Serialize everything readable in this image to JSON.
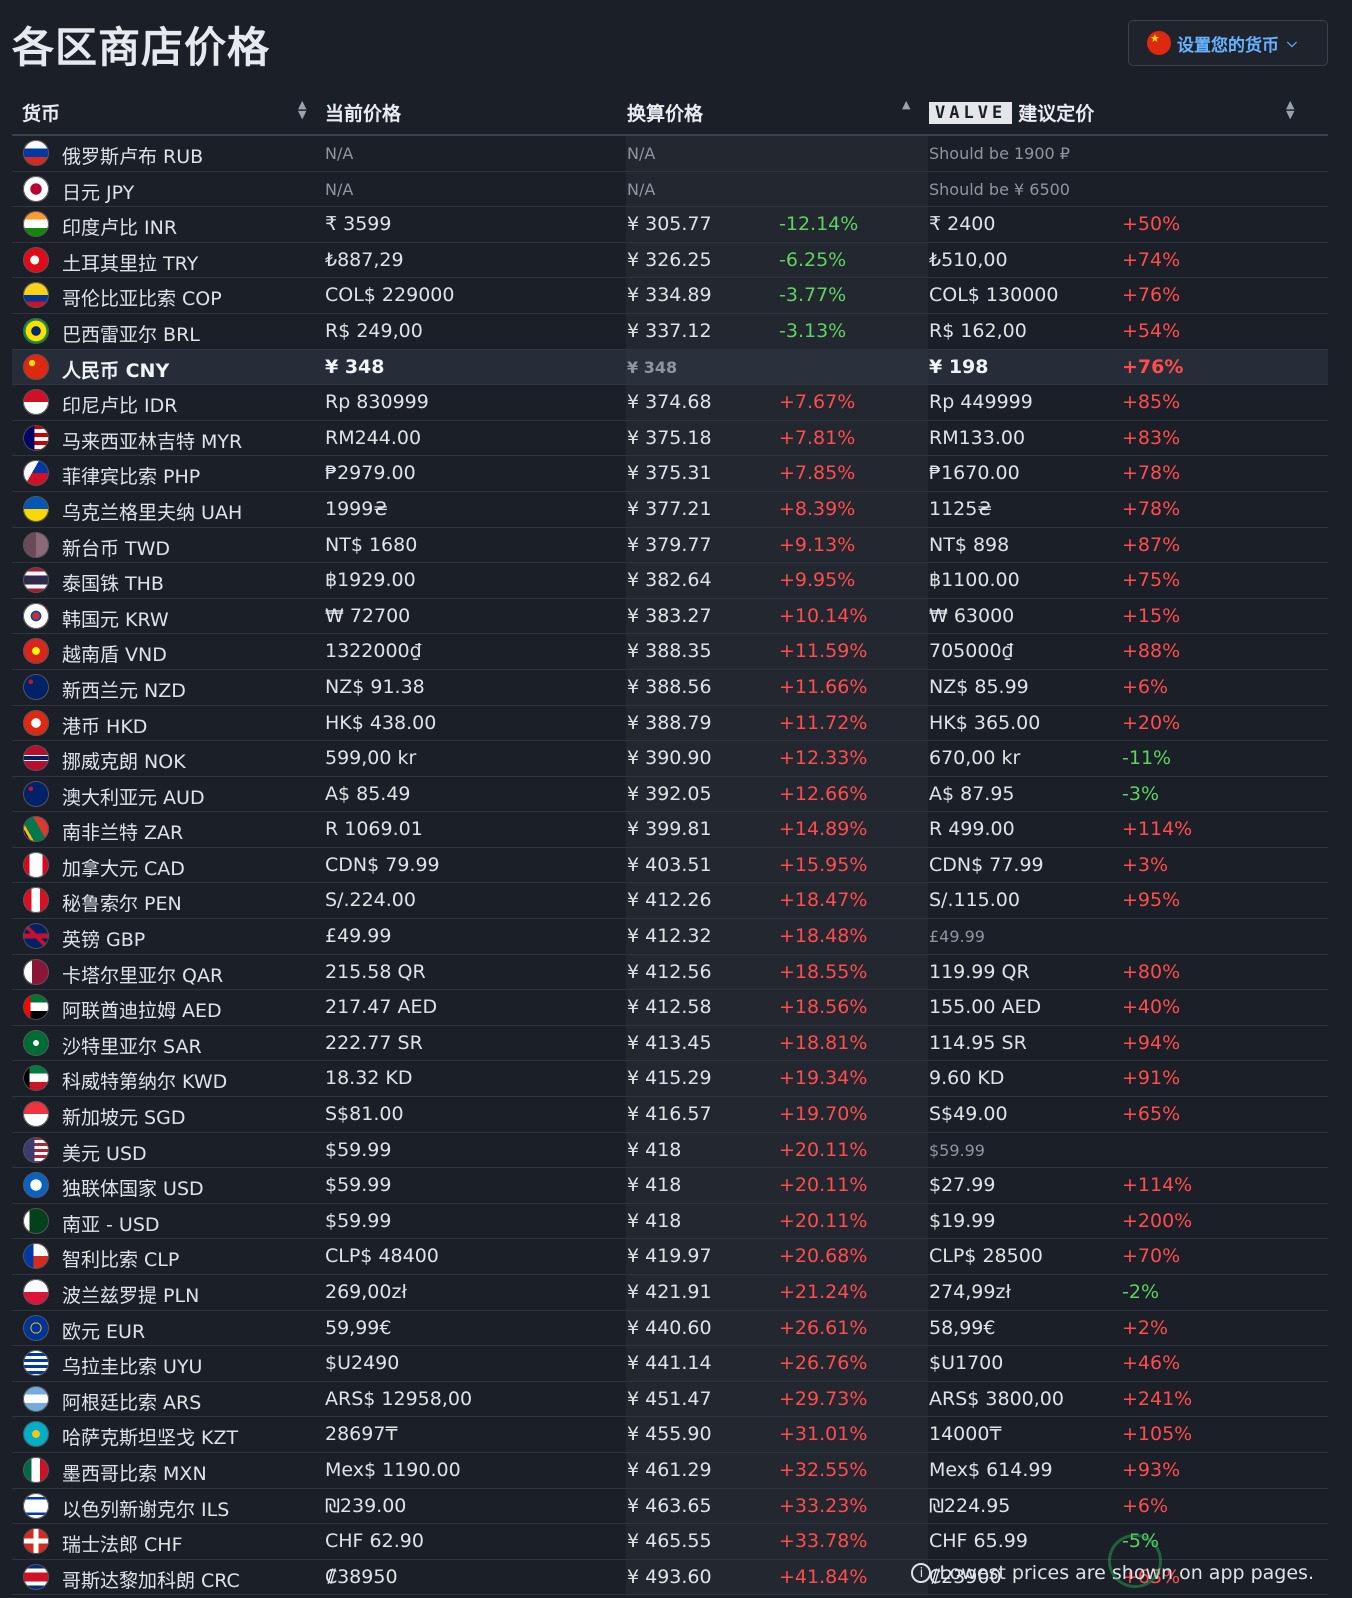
{
  "page": {
    "title": "各区商店价格",
    "currency_button": "设置您的货币",
    "footer_note": "Lowest prices are shown on app pages."
  },
  "colors": {
    "up": "#ff4c4c",
    "down": "#5fd35f",
    "accent": "#66b3ff"
  },
  "headers": {
    "currency": "货币",
    "current_price": "当前价格",
    "converted_price": "换算价格",
    "valve_logo": "VALVE",
    "suggested_price": "建议定价"
  },
  "rows": [
    {
      "flag": "ru",
      "name": "俄罗斯卢布 RUB",
      "price": "N/A",
      "conv": "N/A",
      "diff": "",
      "sugg": "Should be 1900 ₽",
      "pct": "",
      "diff_dir": "",
      "pct_dir": "",
      "na": true
    },
    {
      "flag": "jp",
      "name": "日元 JPY",
      "price": "N/A",
      "conv": "N/A",
      "diff": "",
      "sugg": "Should be ¥ 6500",
      "pct": "",
      "diff_dir": "",
      "pct_dir": "",
      "na": true
    },
    {
      "flag": "in",
      "name": "印度卢比 INR",
      "price": "₹ 3599",
      "conv": "¥ 305.77",
      "diff": "-12.14%",
      "sugg": "₹ 2400",
      "pct": "+50%",
      "diff_dir": "down",
      "pct_dir": "up"
    },
    {
      "flag": "tr",
      "name": "土耳其里拉 TRY",
      "price": "₺887,29",
      "conv": "¥ 326.25",
      "diff": "-6.25%",
      "sugg": "₺510,00",
      "pct": "+74%",
      "diff_dir": "down",
      "pct_dir": "up"
    },
    {
      "flag": "co",
      "name": "哥伦比亚比索 COP",
      "price": "COL$ 229000",
      "conv": "¥ 334.89",
      "diff": "-3.77%",
      "sugg": "COL$ 130000",
      "pct": "+76%",
      "diff_dir": "down",
      "pct_dir": "up"
    },
    {
      "flag": "br",
      "name": "巴西雷亚尔 BRL",
      "price": "R$ 249,00",
      "conv": "¥ 337.12",
      "diff": "-3.13%",
      "sugg": "R$ 162,00",
      "pct": "+54%",
      "diff_dir": "down",
      "pct_dir": "up"
    },
    {
      "flag": "cn",
      "name": "人民币 CNY",
      "price": "¥ 348",
      "conv": "¥ 348",
      "diff": "",
      "sugg": "¥ 198",
      "pct": "+76%",
      "diff_dir": "",
      "pct_dir": "up",
      "highlight": true
    },
    {
      "flag": "id",
      "name": "印尼卢比 IDR",
      "price": "Rp 830999",
      "conv": "¥ 374.68",
      "diff": "+7.67%",
      "sugg": "Rp 449999",
      "pct": "+85%",
      "diff_dir": "up",
      "pct_dir": "up"
    },
    {
      "flag": "my",
      "name": "马来西亚林吉特 MYR",
      "price": "RM244.00",
      "conv": "¥ 375.18",
      "diff": "+7.81%",
      "sugg": "RM133.00",
      "pct": "+83%",
      "diff_dir": "up",
      "pct_dir": "up"
    },
    {
      "flag": "ph",
      "name": "菲律宾比索 PHP",
      "price": "₱2979.00",
      "conv": "¥ 375.31",
      "diff": "+7.85%",
      "sugg": "₱1670.00",
      "pct": "+78%",
      "diff_dir": "up",
      "pct_dir": "up"
    },
    {
      "flag": "ua",
      "name": "乌克兰格里夫纳 UAH",
      "price": "1999₴",
      "conv": "¥ 377.21",
      "diff": "+8.39%",
      "sugg": "1125₴",
      "pct": "+78%",
      "diff_dir": "up",
      "pct_dir": "up"
    },
    {
      "flag": "tw",
      "name": "新台币 TWD",
      "price": "NT$ 1680",
      "conv": "¥ 379.77",
      "diff": "+9.13%",
      "sugg": "NT$ 898",
      "pct": "+87%",
      "diff_dir": "up",
      "pct_dir": "up"
    },
    {
      "flag": "th",
      "name": "泰国铢 THB",
      "price": "฿1929.00",
      "conv": "¥ 382.64",
      "diff": "+9.95%",
      "sugg": "฿1100.00",
      "pct": "+75%",
      "diff_dir": "up",
      "pct_dir": "up"
    },
    {
      "flag": "kr",
      "name": "韩国元 KRW",
      "price": "₩ 72700",
      "conv": "¥ 383.27",
      "diff": "+10.14%",
      "sugg": "₩ 63000",
      "pct": "+15%",
      "diff_dir": "up",
      "pct_dir": "up"
    },
    {
      "flag": "vn",
      "name": "越南盾 VND",
      "price": "1322000₫",
      "conv": "¥ 388.35",
      "diff": "+11.59%",
      "sugg": "705000₫",
      "pct": "+88%",
      "diff_dir": "up",
      "pct_dir": "up"
    },
    {
      "flag": "nz",
      "name": "新西兰元 NZD",
      "price": "NZ$ 91.38",
      "conv": "¥ 388.56",
      "diff": "+11.66%",
      "sugg": "NZ$ 85.99",
      "pct": "+6%",
      "diff_dir": "up",
      "pct_dir": "up"
    },
    {
      "flag": "hk",
      "name": "港币 HKD",
      "price": "HK$ 438.00",
      "conv": "¥ 388.79",
      "diff": "+11.72%",
      "sugg": "HK$ 365.00",
      "pct": "+20%",
      "diff_dir": "up",
      "pct_dir": "up"
    },
    {
      "flag": "no",
      "name": "挪威克朗 NOK",
      "price": "599,00 kr",
      "conv": "¥ 390.90",
      "diff": "+12.33%",
      "sugg": "670,00 kr",
      "pct": "-11%",
      "diff_dir": "up",
      "pct_dir": "down"
    },
    {
      "flag": "au",
      "name": "澳大利亚元 AUD",
      "price": "A$ 85.49",
      "conv": "¥ 392.05",
      "diff": "+12.66%",
      "sugg": "A$ 87.95",
      "pct": "-3%",
      "diff_dir": "up",
      "pct_dir": "down"
    },
    {
      "flag": "za",
      "name": "南非兰特 ZAR",
      "price": "R 1069.01",
      "conv": "¥ 399.81",
      "diff": "+14.89%",
      "sugg": "R 499.00",
      "pct": "+114%",
      "diff_dir": "up",
      "pct_dir": "up"
    },
    {
      "flag": "ca",
      "name": "加拿大元 CAD",
      "price": "CDN$ 79.99",
      "conv": "¥ 403.51",
      "diff": "+15.95%",
      "sugg": "CDN$ 77.99",
      "pct": "+3%",
      "diff_dir": "up",
      "pct_dir": "up"
    },
    {
      "flag": "pe",
      "name": "秘鲁索尔 PEN",
      "price": "S/.224.00",
      "conv": "¥ 412.26",
      "diff": "+18.47%",
      "sugg": "S/.115.00",
      "pct": "+95%",
      "diff_dir": "up",
      "pct_dir": "up"
    },
    {
      "flag": "gb",
      "name": "英镑 GBP",
      "price": "£49.99",
      "conv": "¥ 412.32",
      "diff": "+18.48%",
      "sugg": "£49.99",
      "pct": "",
      "diff_dir": "up",
      "pct_dir": "",
      "sugg_dim": true
    },
    {
      "flag": "qa",
      "name": "卡塔尔里亚尔 QAR",
      "price": "215.58 QR",
      "conv": "¥ 412.56",
      "diff": "+18.55%",
      "sugg": "119.99 QR",
      "pct": "+80%",
      "diff_dir": "up",
      "pct_dir": "up"
    },
    {
      "flag": "ae",
      "name": "阿联酋迪拉姆 AED",
      "price": "217.47 AED",
      "conv": "¥ 412.58",
      "diff": "+18.56%",
      "sugg": "155.00 AED",
      "pct": "+40%",
      "diff_dir": "up",
      "pct_dir": "up"
    },
    {
      "flag": "sa",
      "name": "沙特里亚尔 SAR",
      "price": "222.77 SR",
      "conv": "¥ 413.45",
      "diff": "+18.81%",
      "sugg": "114.95 SR",
      "pct": "+94%",
      "diff_dir": "up",
      "pct_dir": "up"
    },
    {
      "flag": "kw",
      "name": "科威特第纳尔 KWD",
      "price": "18.32 KD",
      "conv": "¥ 415.29",
      "diff": "+19.34%",
      "sugg": "9.60 KD",
      "pct": "+91%",
      "diff_dir": "up",
      "pct_dir": "up"
    },
    {
      "flag": "sg",
      "name": "新加坡元 SGD",
      "price": "S$81.00",
      "conv": "¥ 416.57",
      "diff": "+19.70%",
      "sugg": "S$49.00",
      "pct": "+65%",
      "diff_dir": "up",
      "pct_dir": "up"
    },
    {
      "flag": "us",
      "name": "美元 USD",
      "price": "$59.99",
      "conv": "¥ 418",
      "diff": "+20.11%",
      "sugg": "$59.99",
      "pct": "",
      "diff_dir": "up",
      "pct_dir": "",
      "sugg_dim": true
    },
    {
      "flag": "cis",
      "name": "独联体国家 USD",
      "price": "$59.99",
      "conv": "¥ 418",
      "diff": "+20.11%",
      "sugg": "$27.99",
      "pct": "+114%",
      "diff_dir": "up",
      "pct_dir": "up"
    },
    {
      "flag": "pk",
      "name": "南亚 - USD",
      "price": "$59.99",
      "conv": "¥ 418",
      "diff": "+20.11%",
      "sugg": "$19.99",
      "pct": "+200%",
      "diff_dir": "up",
      "pct_dir": "up"
    },
    {
      "flag": "cl",
      "name": "智利比索 CLP",
      "price": "CLP$ 48400",
      "conv": "¥ 419.97",
      "diff": "+20.68%",
      "sugg": "CLP$ 28500",
      "pct": "+70%",
      "diff_dir": "up",
      "pct_dir": "up"
    },
    {
      "flag": "pl",
      "name": "波兰兹罗提 PLN",
      "price": "269,00zł",
      "conv": "¥ 421.91",
      "diff": "+21.24%",
      "sugg": "274,99zł",
      "pct": "-2%",
      "diff_dir": "up",
      "pct_dir": "down"
    },
    {
      "flag": "eu",
      "name": "欧元 EUR",
      "price": "59,99€",
      "conv": "¥ 440.60",
      "diff": "+26.61%",
      "sugg": "58,99€",
      "pct": "+2%",
      "diff_dir": "up",
      "pct_dir": "up"
    },
    {
      "flag": "uy",
      "name": "乌拉圭比索 UYU",
      "price": "$U2490",
      "conv": "¥ 441.14",
      "diff": "+26.76%",
      "sugg": "$U1700",
      "pct": "+46%",
      "diff_dir": "up",
      "pct_dir": "up"
    },
    {
      "flag": "ar",
      "name": "阿根廷比索 ARS",
      "price": "ARS$ 12958,00",
      "conv": "¥ 451.47",
      "diff": "+29.73%",
      "sugg": "ARS$ 3800,00",
      "pct": "+241%",
      "diff_dir": "up",
      "pct_dir": "up"
    },
    {
      "flag": "kz",
      "name": "哈萨克斯坦坚戈 KZT",
      "price": "28697₸",
      "conv": "¥ 455.90",
      "diff": "+31.01%",
      "sugg": "14000₸",
      "pct": "+105%",
      "diff_dir": "up",
      "pct_dir": "up"
    },
    {
      "flag": "mx",
      "name": "墨西哥比索 MXN",
      "price": "Mex$ 1190.00",
      "conv": "¥ 461.29",
      "diff": "+32.55%",
      "sugg": "Mex$ 614.99",
      "pct": "+93%",
      "diff_dir": "up",
      "pct_dir": "up"
    },
    {
      "flag": "il",
      "name": "以色列新谢克尔 ILS",
      "price": "₪239.00",
      "conv": "¥ 463.65",
      "diff": "+33.23%",
      "sugg": "₪224.95",
      "pct": "+6%",
      "diff_dir": "up",
      "pct_dir": "up"
    },
    {
      "flag": "ch",
      "name": "瑞士法郎 CHF",
      "price": "CHF 62.90",
      "conv": "¥ 465.55",
      "diff": "+33.78%",
      "sugg": "CHF 65.99",
      "pct": "-5%",
      "diff_dir": "up",
      "pct_dir": "down"
    },
    {
      "flag": "cr",
      "name": "哥斯达黎加科朗 CRC",
      "price": "₡38950",
      "conv": "¥ 493.60",
      "diff": "+41.84%",
      "sugg": "₡23900",
      "pct": "+63%",
      "diff_dir": "up",
      "pct_dir": "up"
    }
  ]
}
